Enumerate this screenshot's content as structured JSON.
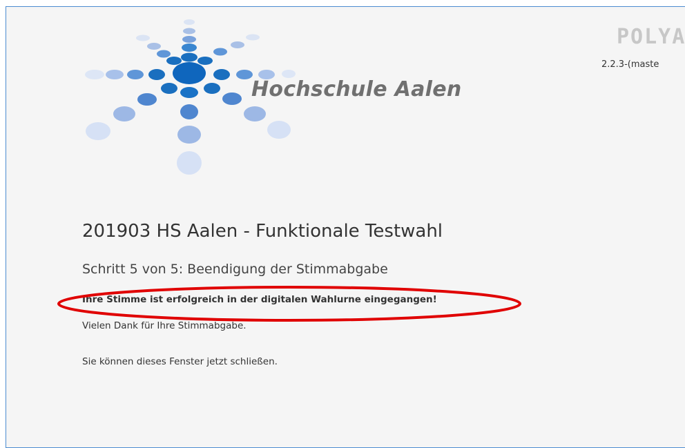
{
  "header": {
    "brand_name": "Hochschule Aalen",
    "product_name": "POLYA",
    "version": "2.2.3-(maste"
  },
  "election": {
    "title": "201903 HS Aalen - Funktionale Testwahl",
    "step": "Schritt 5 von 5: Beendigung der Stimmabgabe",
    "confirmation": "Ihre Stimme ist erfolgreich in der digitalen Wahlurne eingegangen!",
    "thanks": "Vielen Dank für Ihre Stimmabgabe.",
    "close_note": "Sie können dieses Fenster jetzt schließen."
  },
  "annotation": {
    "highlight_color": "#e00000"
  },
  "colors": {
    "frame_border": "#4a8bd0",
    "logo_dark": "#1a6fbf",
    "logo_light": "#cfdcf3"
  }
}
